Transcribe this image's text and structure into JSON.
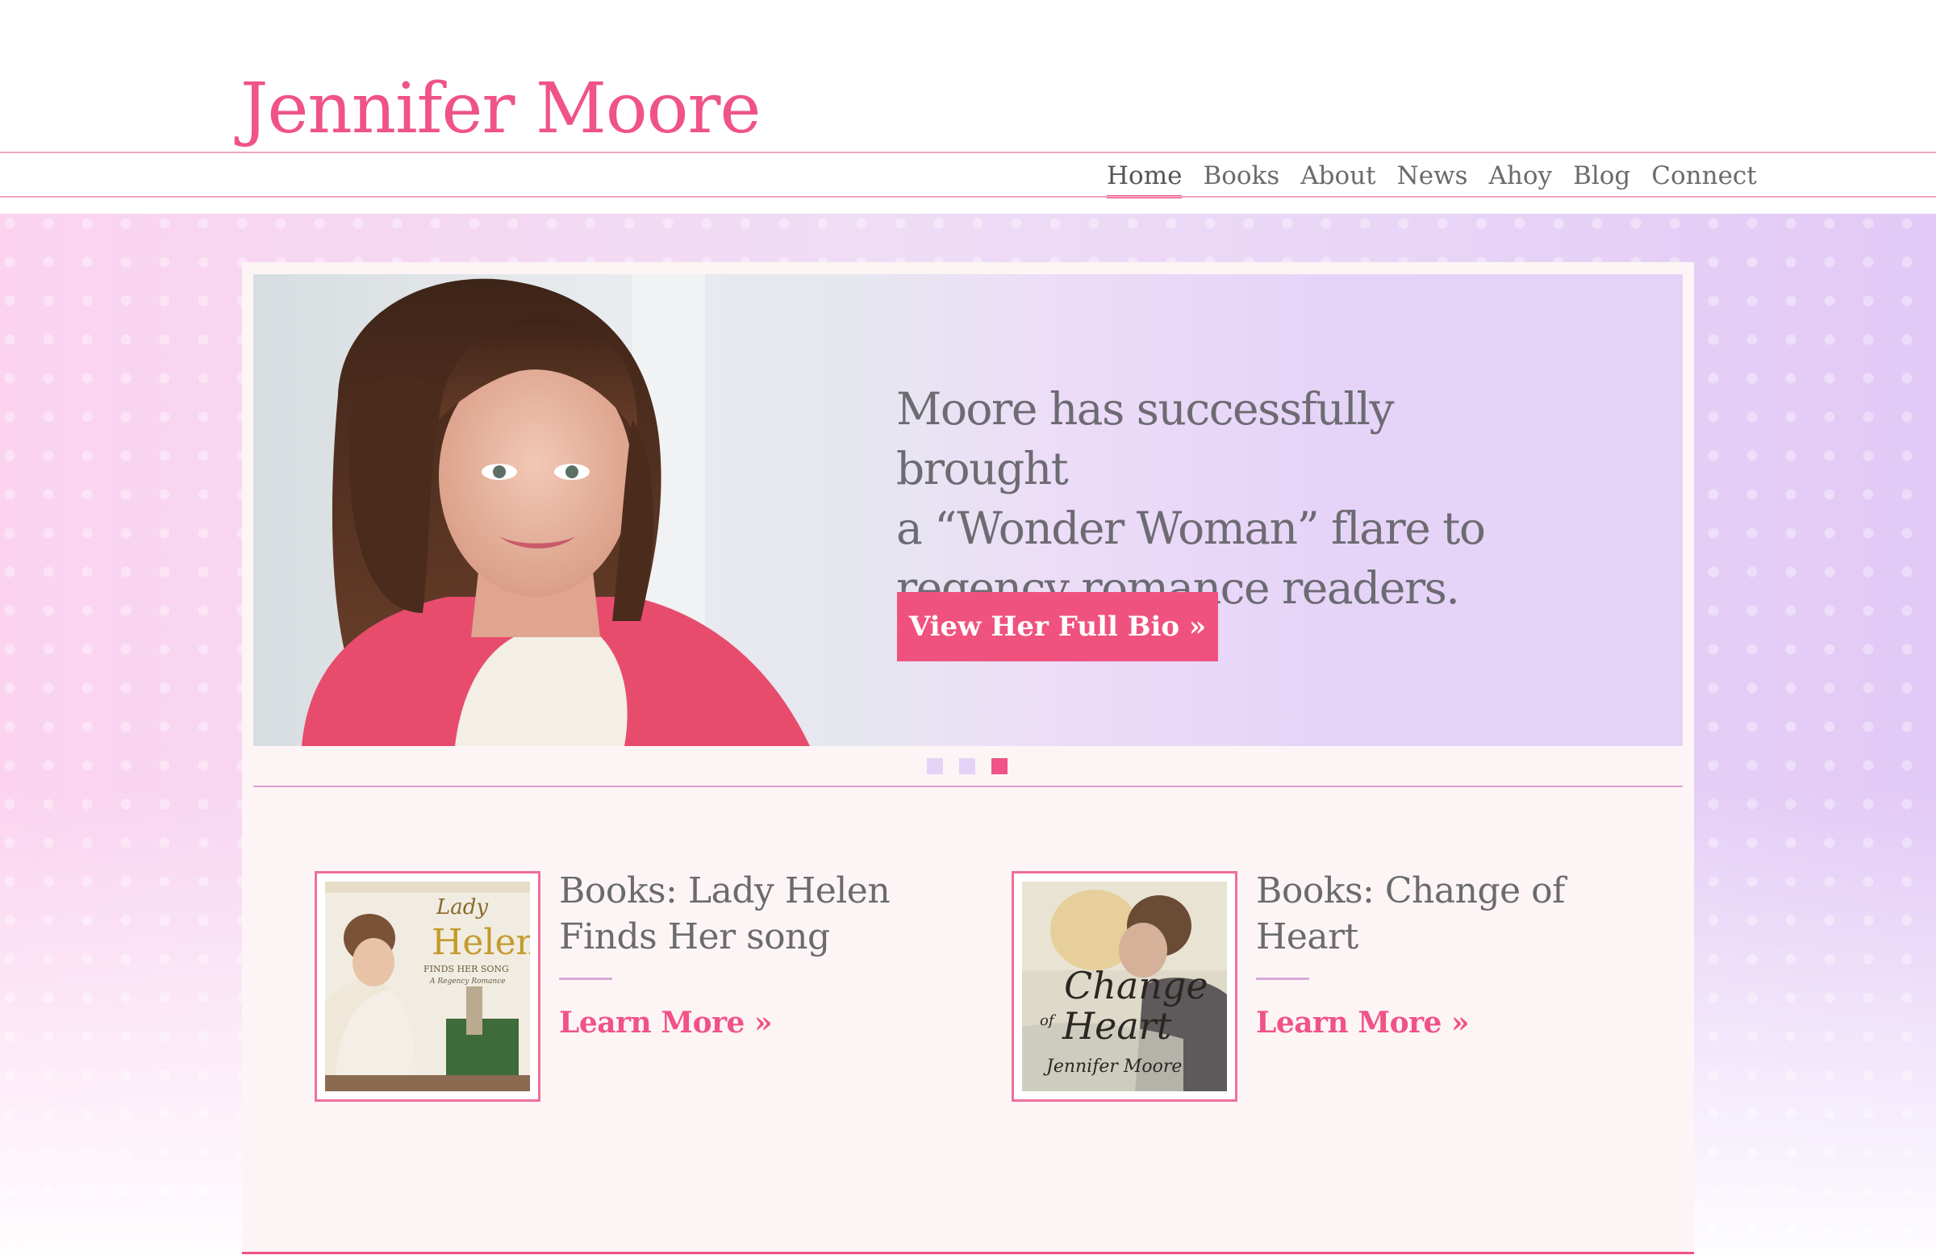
{
  "site": {
    "title": "Jennifer Moore"
  },
  "nav": {
    "items": [
      {
        "label": "Home",
        "active": true
      },
      {
        "label": "Books"
      },
      {
        "label": "About"
      },
      {
        "label": "News"
      },
      {
        "label": "Ahoy"
      },
      {
        "label": "Blog"
      },
      {
        "label": "Connect"
      }
    ]
  },
  "hero": {
    "quote_lines": [
      "Moore has successfully brought",
      "a “Wonder Woman” flare to",
      "regency romance readers."
    ],
    "button_label": "View Her Full Bio »",
    "slides_total": 3,
    "active_slide": 3
  },
  "books": [
    {
      "title": "Books: Lady Helen Finds Her song",
      "link_label": "Learn More  »",
      "cover_text": {
        "line1": "Lady",
        "line2": "Helen",
        "line3": "FINDS HER SONG",
        "line4": "A Regency Romance"
      }
    },
    {
      "title": "Books: Change of Heart",
      "link_label": "Learn More  »",
      "cover_text": {
        "line1": "Change",
        "line2": "of",
        "line3": "Heart",
        "line4": "Jennifer Moore"
      }
    }
  ],
  "colors": {
    "accent": "#ef5387",
    "button": "#f0527f",
    "text": "#6b6b6b",
    "panel": "#fdf5f5"
  }
}
